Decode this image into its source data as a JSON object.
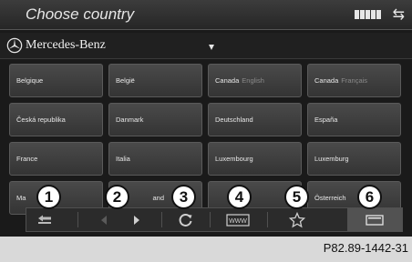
{
  "header": {
    "title": "Choose country",
    "signal_bars": 5,
    "icons": [
      "signal-strength-icon",
      "swap-arrows-icon"
    ]
  },
  "brand": {
    "name": "Mercedes-Benz",
    "icon": "mercedes-star-icon"
  },
  "countries": [
    {
      "label": "Belgique",
      "sub": ""
    },
    {
      "label": "België",
      "sub": ""
    },
    {
      "label": "Canada",
      "sub": "English"
    },
    {
      "label": "Canada",
      "sub": "Français"
    },
    {
      "label": "Česká republika",
      "sub": ""
    },
    {
      "label": "Danmark",
      "sub": ""
    },
    {
      "label": "Deutschland",
      "sub": ""
    },
    {
      "label": "España",
      "sub": ""
    },
    {
      "label": "France",
      "sub": ""
    },
    {
      "label": "Italia",
      "sub": ""
    },
    {
      "label": "Luxembourg",
      "sub": ""
    },
    {
      "label": "Luxemburg",
      "sub": ""
    },
    {
      "label": "Ma",
      "sub": ""
    },
    {
      "label": "and",
      "sub": ""
    },
    {
      "label": "",
      "sub": ""
    },
    {
      "label": "Österreich",
      "sub": ""
    }
  ],
  "toolbar": {
    "items": [
      {
        "icon": "back-icon"
      },
      {
        "icon": "arrow-left-icon"
      },
      {
        "icon": "arrow-right-icon"
      },
      {
        "icon": "reload-icon"
      },
      {
        "icon": "www-icon",
        "label": "WWW"
      },
      {
        "icon": "star-icon"
      },
      {
        "icon": "window-icon"
      }
    ],
    "active": "window-icon"
  },
  "callouts": [
    "1",
    "2",
    "3",
    "4",
    "5",
    "6"
  ],
  "figure_ref": "P82.89-1442-31",
  "colors": {
    "screen_bg": "#1a1a1a",
    "cell_bg": "#3e3e3e",
    "text": "#e8e8e8",
    "page_bg": "#d9d9d9"
  }
}
